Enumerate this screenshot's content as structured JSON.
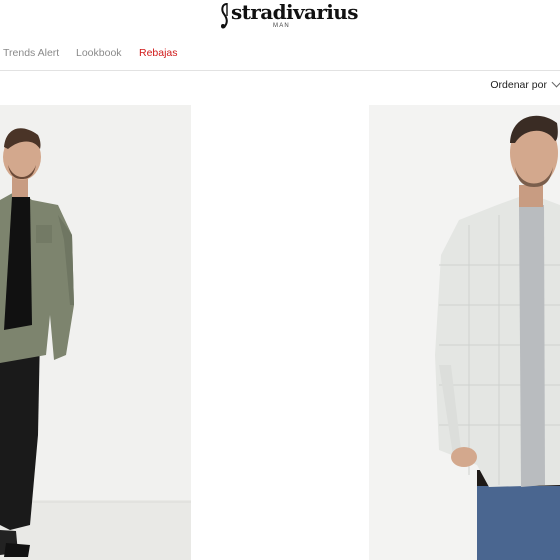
{
  "brand": {
    "name": "stradivarius",
    "sub": "MAN"
  },
  "nav": {
    "items": [
      {
        "label": "Trends Alert",
        "highlight": false
      },
      {
        "label": "Lookbook",
        "highlight": false
      },
      {
        "label": "Rebajas",
        "highlight": true
      }
    ]
  },
  "toolbar": {
    "sort_label": "Ordenar por"
  },
  "products": [
    {
      "image": "model-olive-shirt-black-jeans",
      "colors": {
        "shirt": "#7d846e",
        "tee": "#111111",
        "jeans": "#1a1a1a"
      }
    },
    {
      "image": "model-check-shirt-grey-tee",
      "colors": {
        "shirt": "#e4e6e3",
        "tee": "#b9bcbf",
        "jeans": "#4a6690"
      }
    }
  ],
  "colors": {
    "sale": "#d01a1a",
    "nav_text": "#8a8a8a",
    "divider": "#e2e2e2"
  }
}
